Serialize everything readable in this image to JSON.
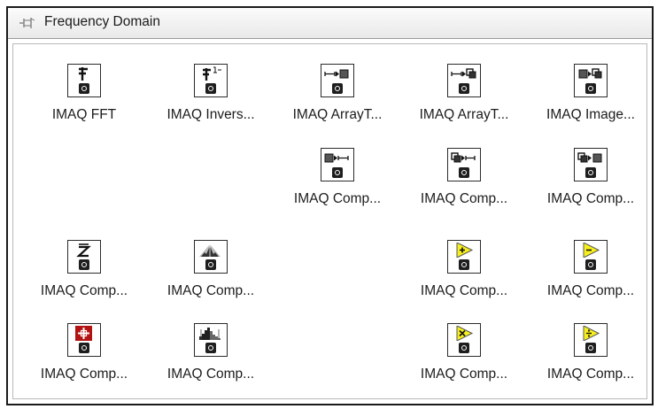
{
  "palette": {
    "title": "Frequency Domain",
    "items": [
      {
        "label": "IMAQ FFT",
        "icon": "fft-icon"
      },
      {
        "label": "IMAQ Invers...",
        "icon": "inverse-fft-icon"
      },
      {
        "label": "IMAQ ArrayT...",
        "icon": "array-to-complex-image-icon"
      },
      {
        "label": "IMAQ ArrayT...",
        "icon": "array-to-complex-plane-icon"
      },
      {
        "label": "IMAQ Image...",
        "icon": "image-to-complex-plane-icon"
      },
      {
        "label": "IMAQ Comp...",
        "icon": "complex-image-to-array-icon"
      },
      {
        "label": "IMAQ Comp...",
        "icon": "complex-plane-to-array-icon"
      },
      {
        "label": "IMAQ Comp...",
        "icon": "complex-plane-to-image-icon"
      },
      {
        "label": "IMAQ Comp...",
        "icon": "complex-conjugate-icon"
      },
      {
        "label": "IMAQ Comp...",
        "icon": "complex-flip-frequency-icon"
      },
      {
        "label": "IMAQ Comp...",
        "icon": "complex-add-icon"
      },
      {
        "label": "IMAQ Comp...",
        "icon": "complex-subtract-icon"
      },
      {
        "label": "IMAQ Comp...",
        "icon": "complex-attenuate-icon"
      },
      {
        "label": "IMAQ Comp...",
        "icon": "complex-truncate-icon"
      },
      {
        "label": "IMAQ Comp...",
        "icon": "complex-multiply-icon"
      },
      {
        "label": "IMAQ Comp...",
        "icon": "complex-divide-icon"
      }
    ]
  }
}
